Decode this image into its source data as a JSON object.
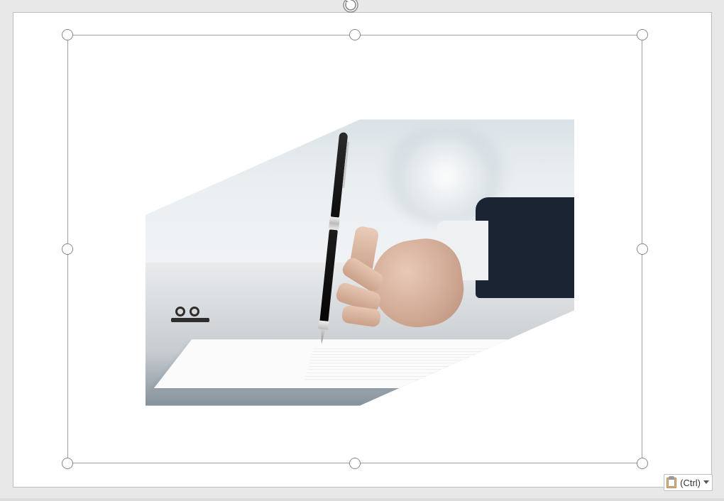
{
  "paste_options": {
    "label": "(Ctrl)",
    "icon_name": "clipboard-paste-icon"
  },
  "rotate_handle": {
    "icon_name": "rotate-icon"
  },
  "image": {
    "description": "hand-signing-document-with-pen",
    "crop_shape": "hexagon"
  }
}
